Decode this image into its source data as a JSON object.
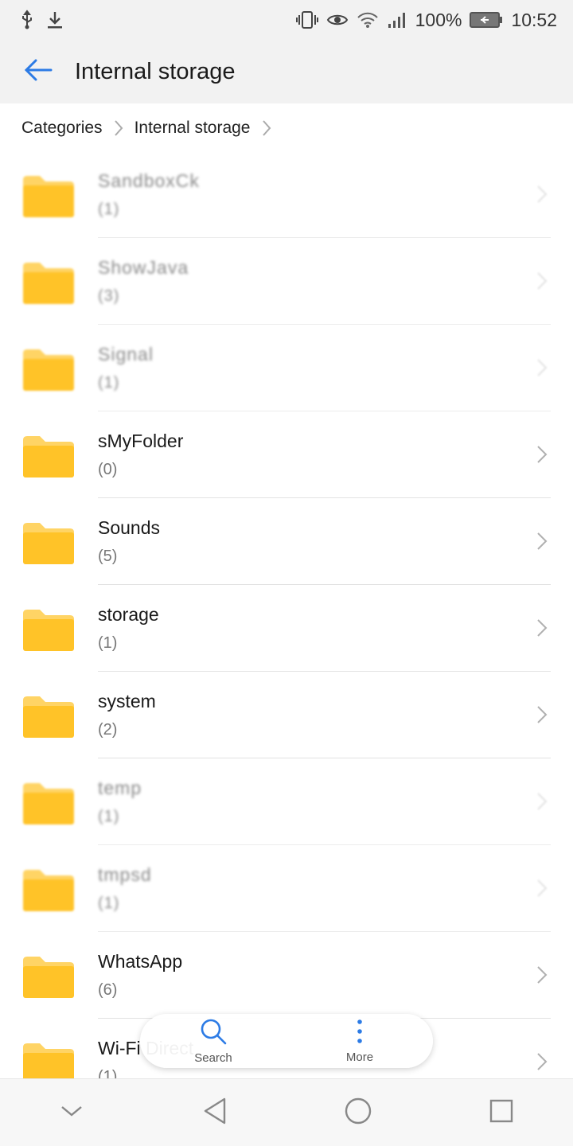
{
  "status_bar": {
    "battery": "100%",
    "time": "10:52",
    "icons": [
      "usb-icon",
      "download-icon",
      "vibrate-icon",
      "eye-icon",
      "wifi-icon",
      "signal-icon",
      "battery-icon"
    ]
  },
  "app_bar": {
    "title": "Internal storage",
    "back_icon": "back-arrow-icon"
  },
  "breadcrumb": {
    "items": [
      "Categories",
      "Internal storage"
    ]
  },
  "colors": {
    "accent": "#2c7be5",
    "folder": "#FFC328",
    "folder_tab": "#FFD465"
  },
  "files": [
    {
      "name": "SandboxCk",
      "count": "(1)",
      "blurred": true
    },
    {
      "name": "ShowJava",
      "count": "(3)",
      "blurred": true
    },
    {
      "name": "Signal",
      "count": "(1)",
      "blurred": true
    },
    {
      "name": "sMyFolder",
      "count": "(0)",
      "blurred": false
    },
    {
      "name": "Sounds",
      "count": "(5)",
      "blurred": false
    },
    {
      "name": "storage",
      "count": "(1)",
      "blurred": false
    },
    {
      "name": "system",
      "count": "(2)",
      "blurred": false
    },
    {
      "name": "temp",
      "count": "(1)",
      "blurred": true
    },
    {
      "name": "tmpsd",
      "count": "(1)",
      "blurred": true
    },
    {
      "name": "WhatsApp",
      "count": "(6)",
      "blurred": false
    },
    {
      "name": "Wi-Fi Direct",
      "count": "(1)",
      "blurred": false
    }
  ],
  "floating_menu": {
    "search_label": "Search",
    "more_label": "More"
  },
  "nav_bar": {
    "icons": [
      "collapse-icon",
      "back-icon",
      "home-icon",
      "recents-icon"
    ]
  }
}
